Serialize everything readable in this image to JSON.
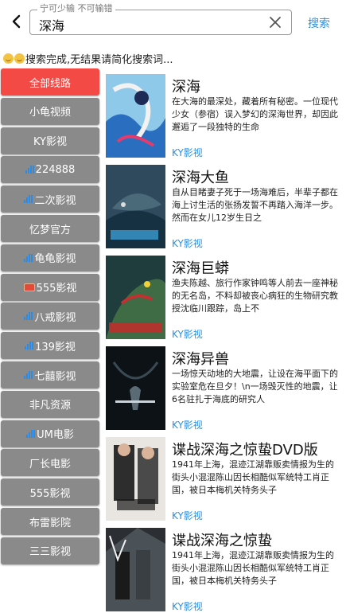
{
  "header": {
    "search_legend": "宁可少输 不可输错",
    "search_value": "深海",
    "search_button": "搜索"
  },
  "status_text": "搜索完成,无结果请简化搜索词...",
  "sidebar": {
    "items": [
      {
        "label": "全部线路",
        "icon": "",
        "active": true
      },
      {
        "label": "小龟视频",
        "icon": ""
      },
      {
        "label": "KY影视",
        "icon": ""
      },
      {
        "label": "224888",
        "icon": "signal-icon"
      },
      {
        "label": "二次影视",
        "icon": "signal-icon"
      },
      {
        "label": "忆梦官方",
        "icon": ""
      },
      {
        "label": "龟龟影视",
        "icon": "signal-icon"
      },
      {
        "label": "555影视",
        "icon": "tv-icon"
      },
      {
        "label": "八戒影视",
        "icon": "signal-icon"
      },
      {
        "label": "139影视",
        "icon": "signal-icon"
      },
      {
        "label": "七囍影视",
        "icon": "signal-icon"
      },
      {
        "label": "非凡资源",
        "icon": ""
      },
      {
        "label": "UM电影",
        "icon": "signal-icon"
      },
      {
        "label": "厂长电影",
        "icon": ""
      },
      {
        "label": "555影视",
        "icon": ""
      },
      {
        "label": "布雷影院",
        "icon": ""
      },
      {
        "label": "三三影视",
        "icon": ""
      }
    ]
  },
  "results": [
    {
      "title": "深海",
      "desc": "在大海的最深处，藏着所有秘密。一位现代少女（参宿）误入梦幻的深海世界，却因此邂逅了一段独特的生命",
      "source": "KY影视",
      "poster_icon": "poster-deep-sea"
    },
    {
      "title": "深海大鱼",
      "desc": "自从目睹妻子死于一场海难后，半辈子都在海上讨生活的张扬发誓不再踏入海洋一步。然而在女儿12岁生日之",
      "source": "KY影视",
      "poster_icon": "poster-big-fish"
    },
    {
      "title": "深海巨蟒",
      "desc": "渔夫陈越、旅行作家钟鸣等人前去一座神秘的无名岛，不料却被丧心病狂的生物研究教授沈临川跟踪，岛上不",
      "source": "KY影视",
      "poster_icon": "poster-python"
    },
    {
      "title": "深海异兽",
      "desc": "一场惊天动地的大地震，让设在海平面下的实验室危在旦夕！\\n一场毁灭性的地震，让6名驻扎于海底的研究人",
      "source": "KY影视",
      "poster_icon": "poster-underwater"
    },
    {
      "title": "谍战深海之惊蛰DVD版",
      "desc": "1941年上海，混迹江湖靠贩卖情报为生的街头小混混陈山因长相酷似军统特工肖正国，被日本梅机关特务头子",
      "source": "KY影视",
      "poster_icon": "poster-spy-dvd"
    },
    {
      "title": "谍战深海之惊蛰",
      "desc": "1941年上海，混迹江湖靠贩卖情报为生的街头小混混陈山因长相酷似军统特工肖正国，被日本梅机关特务头子",
      "source": "KY影视",
      "poster_icon": "poster-spy"
    }
  ],
  "colors": {
    "accent": "#2a8fe0",
    "active": "#f44a46",
    "inactive": "#8a8a8a"
  }
}
